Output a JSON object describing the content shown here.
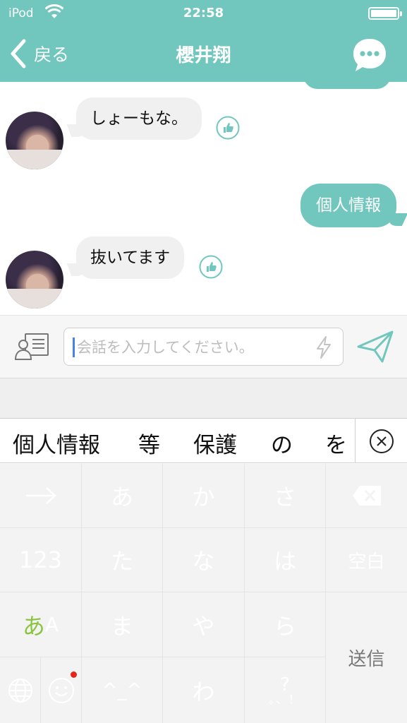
{
  "status_bar": {
    "carrier": "iPod",
    "time": "22:58",
    "wifi_icon": "wifi-icon",
    "battery_icon": "battery-icon",
    "battery_level": 1.0
  },
  "nav": {
    "back_label": "戻る",
    "title": "櫻井翔",
    "menu_icon": "chat-bubble-dots-icon"
  },
  "chat": {
    "messages": [
      {
        "direction": "incoming",
        "text": "しょーもな。"
      },
      {
        "direction": "outgoing",
        "text": "個人情報"
      },
      {
        "direction": "incoming",
        "text": "抜いてます"
      }
    ],
    "like_icon": "thumbs-up-icon"
  },
  "input_bar": {
    "placeholder": "会話を入力してください。",
    "value": "",
    "contact_icon": "contact-card-icon",
    "quick_icon": "lightning-icon",
    "send_icon": "paper-plane-icon"
  },
  "candidates": {
    "items": [
      "個人情報",
      "等",
      "保護",
      "の",
      "を"
    ],
    "close_icon": "circle-x-icon"
  },
  "keyboard": {
    "rows": [
      [
        "→",
        "あ",
        "か",
        "さ",
        "⌫"
      ],
      [
        "123",
        "た",
        "な",
        "は",
        "空白"
      ],
      [
        "あA",
        "ま",
        "や",
        "ら",
        "送信"
      ],
      [
        "🌐",
        "☺",
        "^_^",
        "わ",
        "?!"
      ]
    ],
    "mode_label_jp": "あ",
    "mode_label_en": "A",
    "return_label": "送信",
    "space_label": "空白",
    "number_label": "123",
    "emoticon_label": "^_^",
    "punct_label_top": "?",
    "punct_label_bottom": "。、！",
    "kana": {
      "a": "あ",
      "ka": "か",
      "sa": "さ",
      "ta": "た",
      "na": "な",
      "ha": "は",
      "ma": "ま",
      "ya": "や",
      "ra": "ら",
      "wa": "わ"
    }
  },
  "colors": {
    "accent": "#71c7bd",
    "incoming_bubble": "#f0f0f0",
    "keyboard_bg": "#f3f3f3",
    "mode_green": "#8cc441",
    "notification_red": "#e3261c"
  }
}
